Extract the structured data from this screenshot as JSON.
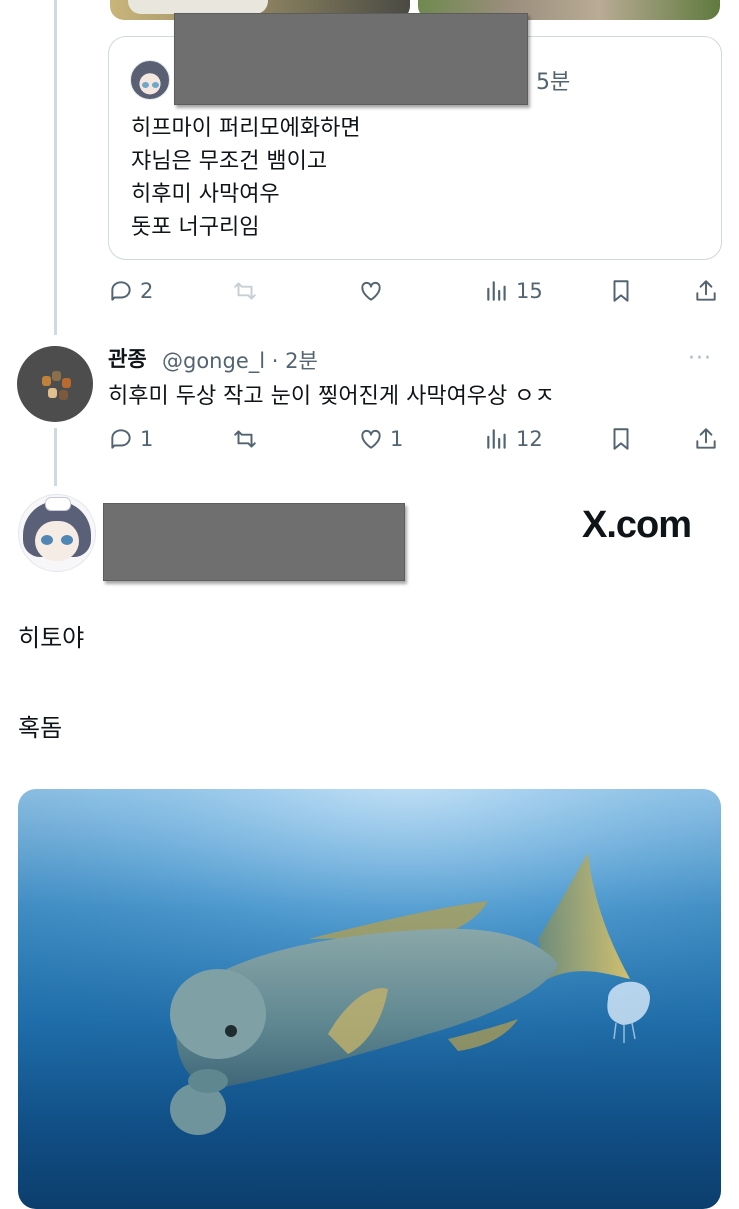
{
  "quoted_tweet": {
    "time": "· 5분",
    "lines": [
      "히프마이 퍼리모에화하면",
      "쟈님은 무조건 뱀이고",
      "히후미 사막여우",
      "돗포 너구리임"
    ],
    "actions": {
      "replies": "2",
      "views": "15"
    }
  },
  "reply": {
    "name": "관종",
    "handle_time": "@gonge_l · 2분",
    "more": "···",
    "text": "히후미 두상 작고 눈이 찢어진게 사막여우상 ㅇㅈ",
    "actions": {
      "replies": "1",
      "likes": "1",
      "views": "12"
    }
  },
  "main_tweet": {
    "watermark": "X.com",
    "lines": [
      "히토야",
      "혹돔"
    ],
    "media_subject": "Asian sheepshead wrasse swimming underwater near a jellyfish"
  },
  "colors": {
    "text": "#0f1419",
    "secondary": "#536471",
    "border": "#cfd9de",
    "redaction": "#6f6f6f"
  },
  "icons": [
    "reply-icon",
    "retweet-icon",
    "like-icon",
    "views-icon",
    "bookmark-icon",
    "share-icon",
    "more-icon"
  ]
}
